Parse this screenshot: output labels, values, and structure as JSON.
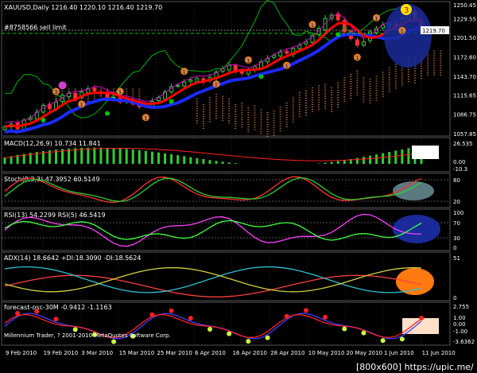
{
  "colors": {
    "background": "#000000",
    "grid": "#3a3a3a",
    "bull_candle": "#32cd32",
    "bear_candle": "#ff3030",
    "ma_blue": "#1a2bff",
    "ma_red": "#ff0000",
    "ma_magenta": "#d000d0",
    "chikou_green": "#00b000",
    "cloud": "#c87840",
    "macd_hist": "#32cd32",
    "macd_signal": "#ff2020",
    "stoch_main": "#ff3030",
    "stoch_signal": "#32cd32",
    "rsi_fast": "#ff40ff",
    "rsi_slow": "#40ff40",
    "adx_line": "#ff4040",
    "di_plus": "#30c0d0",
    "di_minus": "#d0d040",
    "forecast_red": "#ff2020",
    "forecast_blue": "#4040ff",
    "forecast_dots_yellow": "#c8ff40",
    "highlight_blue": "#1a2a9a",
    "highlight_slate": "#5a7a80",
    "highlight_orange": "#ff7a10",
    "highlight_peach": "#ffe0c8"
  },
  "main": {
    "header": "XAUUSD,Daily  1216.40 1220.10 1216.40 1219.70",
    "order_label": "#8758566 sell limit",
    "order_price": 1233.5,
    "current_price": 1219.7,
    "current_price_label": "1219.70",
    "price_axis": [
      "1250.45",
      "1229.55",
      "1201.50",
      "1172.60",
      "1143.70",
      "1115.65",
      "1086.75",
      "1057.85"
    ],
    "chart_data": {
      "type": "line",
      "title": "XAUUSD,Daily",
      "ohlc_last": {
        "open": 1216.4,
        "high": 1220.1,
        "low": 1216.4,
        "close": 1219.7
      },
      "ylim": [
        1057.85,
        1250.45
      ],
      "x_tick_labels": [
        "9 Feb 2010",
        "19 Feb 2010",
        "3 Mar 2010",
        "15 Mar 2010",
        "25 Mar 2010",
        "6 Apr 2010",
        "16 Apr 2010",
        "28 Apr 2010",
        "10 May 2010",
        "20 May 2010",
        "1 Jun 2010",
        "11 Jun 2010"
      ],
      "close_series": [
        1068,
        1072,
        1065,
        1078,
        1082,
        1090,
        1100,
        1095,
        1105,
        1115,
        1118,
        1110,
        1120,
        1125,
        1122,
        1118,
        1110,
        1112,
        1105,
        1108,
        1102,
        1098,
        1100,
        1106,
        1112,
        1120,
        1128,
        1130,
        1135,
        1138,
        1140,
        1135,
        1142,
        1150,
        1155,
        1160,
        1150,
        1148,
        1152,
        1158,
        1165,
        1170,
        1175,
        1180,
        1178,
        1185,
        1190,
        1195,
        1205,
        1215,
        1230,
        1235,
        1228,
        1210,
        1200,
        1190,
        1195,
        1210,
        1215,
        1220,
        1222,
        1218,
        1230,
        1240,
        1228,
        1219.7
      ]
    }
  },
  "markers": {
    "top_badge": "3",
    "diamond_badges": [
      "3",
      "1",
      "1",
      "1",
      "1",
      "1",
      "1",
      "1",
      "1",
      "1",
      "1",
      "1"
    ]
  },
  "indicators": {
    "macd": {
      "label": "MACD(12,26,9) 10.734 11.841",
      "axis": [
        "26.535",
        "0.00",
        "-10.3"
      ],
      "chart_data": {
        "type": "bar",
        "name": "MACD(12,26,9)",
        "main": 10.734,
        "signal": 11.841,
        "ylim": [
          -10.3,
          26.535
        ]
      }
    },
    "stoch": {
      "label": "Stoch(8,3,3) 47.3952 60.5149",
      "axis": [
        "80",
        "20"
      ],
      "chart_data": {
        "type": "line",
        "main": 47.3952,
        "signal": 60.5149,
        "levels": [
          20,
          80
        ]
      }
    },
    "rsi": {
      "label": "RSI(13) 54.2299  RSI(5) 46.5419",
      "axis": [
        "100",
        "70",
        "30",
        "0"
      ],
      "chart_data": {
        "type": "line",
        "rsi13": 54.2299,
        "rsi5": 46.5419,
        "levels": [
          30,
          70
        ]
      }
    },
    "adx": {
      "label": "ADX(14) 18.6642 +DI:18.3090 -DI:18.5624",
      "axis": [
        "51",
        "0"
      ],
      "chart_data": {
        "type": "line",
        "adx": 18.6642,
        "di_plus": 18.309,
        "di_minus": 18.5624
      }
    },
    "forecast": {
      "label": "forecast-osc-30M -0.9412 -1.1163",
      "axis": [
        "2.755",
        "1.00",
        "0.00",
        "-1.00",
        "-3.6362"
      ],
      "chart_data": {
        "type": "line",
        "values": [
          -0.9412,
          -1.1163
        ],
        "ylim": [
          -3.6362,
          2.755
        ]
      }
    }
  },
  "copyright": "Millennium Trader, ? 2001-2010 MetaQuotes Software Corp.",
  "watermark": "[800x600] https://upic.me/"
}
